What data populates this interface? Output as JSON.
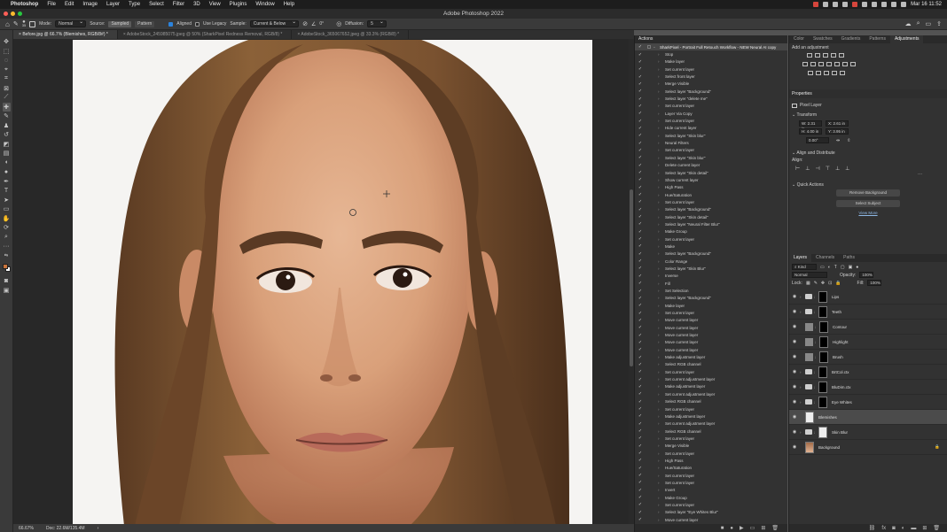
{
  "menubar": {
    "app": "Photoshop",
    "menus": [
      "File",
      "Edit",
      "Image",
      "Layer",
      "Type",
      "Select",
      "Filter",
      "3D",
      "View",
      "Plugins",
      "Window",
      "Help"
    ],
    "clock": "Mar 16  11:52"
  },
  "window": {
    "title": "Adobe Photoshop 2022"
  },
  "options": {
    "brush_size": "35",
    "mode_label": "Mode:",
    "mode_value": "Normal",
    "source_label": "Source:",
    "source_sampled": "Sampled",
    "source_pattern": "Pattern",
    "aligned": "Aligned",
    "use_legacy": "Use Legacy",
    "sample_label": "Sample:",
    "sample_value": "Current & Below",
    "angle": "0°",
    "diffusion_label": "Diffusion:",
    "diffusion_value": "5"
  },
  "doc_tabs": [
    {
      "label": "Before.jpg @ 66.7% (Blemishes, RGB/8#) *",
      "active": true
    },
    {
      "label": "AdobeStock_245985075.jpeg @ 50% (SharkPixel Redness Removal, RGB/8) *",
      "active": false
    },
    {
      "label": "AdobeStock_365067652.jpeg @ 33.3% (RGB/8) *",
      "active": false
    }
  ],
  "status": {
    "zoom": "66.67%",
    "doc": "Doc: 22.6M/135.4M"
  },
  "actions": {
    "title": "Actions",
    "set_name": "SharkPixel - Portrait Full Retouch Workflow - NEW Neural AI copy",
    "items": [
      "Stop",
      "Make layer",
      "Set current layer",
      "Select front layer",
      "Merge Visible",
      "Select layer \"Background\"",
      "Select layer \"delete me\"",
      "Set current layer",
      "Layer Via Copy",
      "Set current layer",
      "Hide current layer",
      "Select layer \"Skin blur\"",
      "Neural Filters",
      "Set current layer",
      "Select layer \"Skin blur\"",
      "Delete current layer",
      "Select layer \"Skin detail\"",
      "Show current layer",
      "High Pass",
      "Hue/Saturation",
      "Set current layer",
      "Select layer \"Background\"",
      "Select layer \"Skin detail\"",
      "Select layer \"Neural Filter Blur\"",
      "Make Group",
      "Set current layer",
      "Make",
      "Select layer \"Background\"",
      "Color Range",
      "Select layer \"Skin Blur\"",
      "Inverse",
      "Fill",
      "Set Selection",
      "Select layer \"Background\"",
      "Make layer",
      "Set current layer",
      "Move current layer",
      "Move current layer",
      "Move current layer",
      "Move current layer",
      "Move current layer",
      "Make adjustment layer",
      "Select RGB channel",
      "Set current layer",
      "Set current adjustment layer",
      "Make adjustment layer",
      "Set current adjustment layer",
      "Select RGB channel",
      "Set current layer",
      "Make adjustment layer",
      "Set current adjustment layer",
      "Select RGB channel",
      "Set current layer",
      "Merge Visible",
      "Set current layer",
      "High Pass",
      "Hue/Saturation",
      "Set current layer",
      "Set current layer",
      "Invert",
      "Make Group",
      "Set current layer",
      "Select layer \"Eye Whites Blur\"",
      "Move current layer"
    ]
  },
  "right_tabs": [
    "Color",
    "Swatches",
    "Gradients",
    "Patterns",
    "Adjustments"
  ],
  "adjustments": {
    "add_label": "Add an adjustment"
  },
  "properties": {
    "title": "Properties",
    "layer_type": "Pixel Layer",
    "transform": "Transform",
    "w": "W: 2.31 in",
    "x": "X: 2.61 in",
    "h": "H: 4.00 in",
    "y": "Y: 3.95 in",
    "angle": "0.00°",
    "align": "Align and Distribute",
    "align_label": "Align:",
    "quick": "Quick Actions",
    "remove_bg": "Remove Background",
    "select_subject": "Select Subject",
    "view_more": "View More"
  },
  "layers_panel": {
    "tabs": [
      "Layers",
      "Channels",
      "Paths"
    ],
    "kind": "Kind",
    "blend": "Normal",
    "opacity_label": "Opacity:",
    "opacity": "100%",
    "lock_label": "Lock:",
    "fill_label": "Fill:",
    "fill": "100%",
    "layers": [
      {
        "name": "Lips",
        "type": "group"
      },
      {
        "name": "Teeth",
        "type": "group"
      },
      {
        "name": "Contour",
        "type": "adj"
      },
      {
        "name": "Highlight",
        "type": "adj"
      },
      {
        "name": "Brush",
        "type": "adj"
      },
      {
        "name": "BrtCol.ctx",
        "type": "group"
      },
      {
        "name": "BluDim.ctx",
        "type": "group"
      },
      {
        "name": "Eye Whites",
        "type": "group"
      },
      {
        "name": "Blemishes",
        "type": "pixel",
        "selected": true
      },
      {
        "name": "Skin Blur",
        "type": "mask"
      },
      {
        "name": "Background",
        "type": "photo"
      }
    ]
  }
}
